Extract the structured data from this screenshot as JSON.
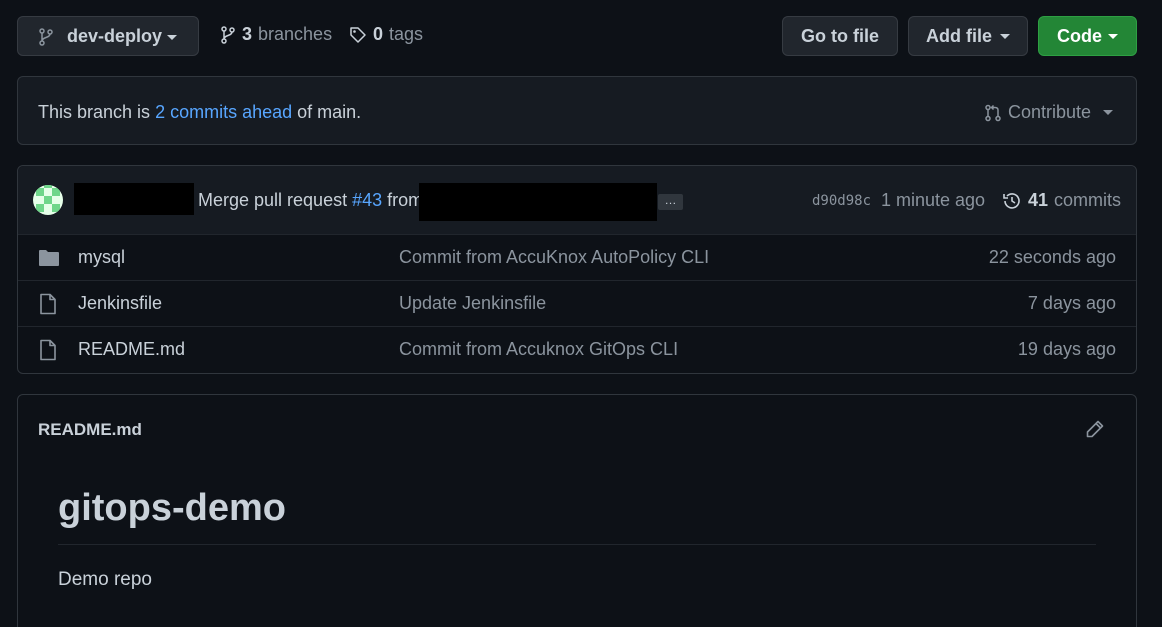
{
  "toolbar": {
    "branch_name": "dev-deploy",
    "branches_count": "3",
    "branches_label": "branches",
    "tags_count": "0",
    "tags_label": "tags",
    "go_to_file_label": "Go to file",
    "add_file_label": "Add file",
    "code_label": "Code"
  },
  "branch_status": {
    "prefix": "This branch is",
    "ahead_link": "2 commits ahead",
    "suffix": "of main.",
    "contribute_label": "Contribute"
  },
  "latest_commit": {
    "message_prefix": "Merge pull request",
    "pr_number": "#43",
    "message_from": "from",
    "ellipsis": "…",
    "sha": "d90d98c",
    "time": "1 minute ago",
    "commits_count": "41",
    "commits_label": "commits"
  },
  "files": [
    {
      "type": "folder",
      "icon": "folder-icon",
      "name": "mysql",
      "message": "Commit from AccuKnox AutoPolicy CLI",
      "time": "22 seconds ago"
    },
    {
      "type": "file",
      "icon": "file-icon",
      "name": "Jenkinsfile",
      "message": "Update Jenkinsfile",
      "time": "7 days ago"
    },
    {
      "type": "file",
      "icon": "file-icon",
      "name": "README.md",
      "message": "Commit from Accuknox GitOps CLI",
      "time": "19 days ago"
    }
  ],
  "readme": {
    "filename": "README.md",
    "heading": "gitops-demo",
    "body": "Demo repo"
  },
  "colors": {
    "background": "#0d1117",
    "green_button": "#238636",
    "link": "#58a6ff"
  }
}
